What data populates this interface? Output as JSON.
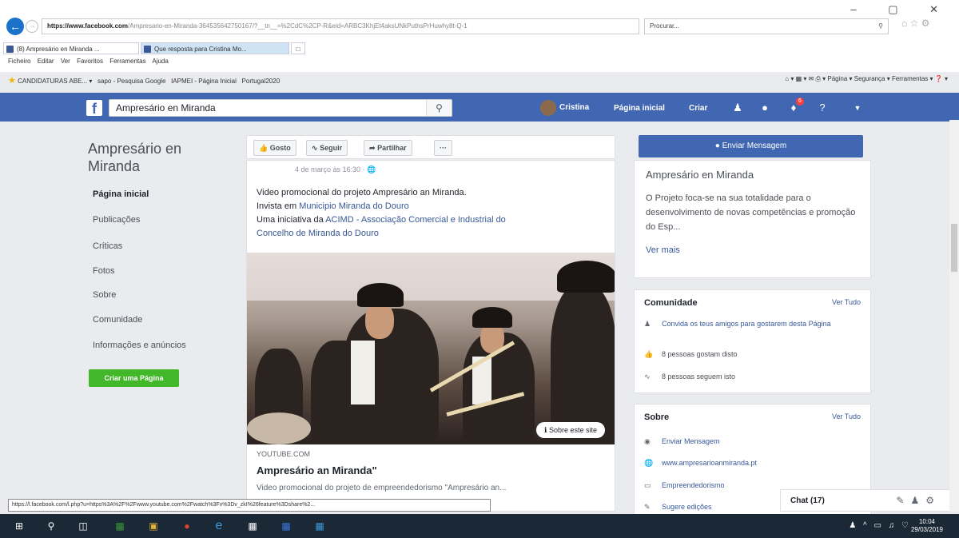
{
  "browser": {
    "window_controls": "–  ▢  ✕",
    "address_host": "https://www.facebook.com",
    "address_rest": "/Ampresario-en-Miranda-364535642750167/?__tn__=%2CdC%2CP-R&eid=ARBC3KhjEt4aksUNkPuthsPrHuwhy8t-Q-1",
    "search_placeholder": "Procurar...",
    "tabs": [
      {
        "label": "(8) Ampresário en Miranda ..."
      },
      {
        "label": "Que resposta para Cristina Mo..."
      }
    ],
    "menu": [
      "Ficheiro",
      "Editar",
      "Ver",
      "Favoritos",
      "Ferramentas",
      "Ajuda"
    ],
    "favorites": [
      "CANDIDATURAS ABE...",
      "sapo - Pesquisa Google",
      "IAPMEI - Página Inicial",
      "Portugal2020"
    ],
    "commands": [
      "Página",
      "Segurança",
      "Ferramentas"
    ],
    "status_url": "https://l.facebook.com/l.php?u=https%3A%2F%2Fwww.youtube.com%2Fwatch%3Fv%3Dv_zkI%26feature%3Dshare%2..."
  },
  "fb": {
    "search_value": "Ampresário en Miranda",
    "user_name": "Cristina",
    "nav": [
      "Página inicial",
      "Criar"
    ],
    "notif_count": "6"
  },
  "page": {
    "name": "Ampresário en Miranda",
    "left_nav": [
      "Página inicial",
      "Publicações",
      "Críticas",
      "Fotos",
      "Sobre",
      "Comunidade",
      "Informações e anúncios"
    ],
    "create_page": "Criar uma Página"
  },
  "actions": {
    "like": "Gosto",
    "follow": "Seguir",
    "share": "Partilhar",
    "more": "···"
  },
  "post": {
    "date": "4 de março às 16:30",
    "line1": "Video promocional do projeto Ampresário an Miranda.",
    "line2_prefix": "Invista em ",
    "line2_link": "Municipio Miranda do Douro",
    "line3_prefix": "Uma iniciativa da ",
    "line3_link": "ACIMD - Associação Comercial e Industrial do",
    "line4_link": "Concelho de Miranda do Douro",
    "about_site": "Sobre este site",
    "link_source": "YOUTUBE.COM",
    "link_title": "Ampresário an Miranda\"",
    "link_desc": "Video promocional do projeto de empreendedorismo \"Ampresário an..."
  },
  "right": {
    "send_message": "Enviar Mensagem",
    "about_title": "Ampresário en Miranda",
    "about_desc": "O Projeto foca-se na sua totalidade para o desenvolvimento de novas competências e promoção do Esp...",
    "see_more": "Ver mais",
    "community": {
      "title": "Comunidade",
      "see_all": "Ver Tudo",
      "invite": "Convida os teus amigos para gostarem desta Página",
      "likes": "8 pessoas gostam disto",
      "follows": "8 pessoas seguem isto"
    },
    "sobre": {
      "title": "Sobre",
      "see_all": "Ver Tudo",
      "message": "Enviar Mensagem",
      "website": "www.ampresarioanmiranda.pt",
      "category": "Empreendedorismo",
      "suggest": "Sugere edições"
    }
  },
  "chat": {
    "label": "Chat (17)"
  },
  "taskbar": {
    "time": "10:04",
    "date": "29/03/2019"
  }
}
